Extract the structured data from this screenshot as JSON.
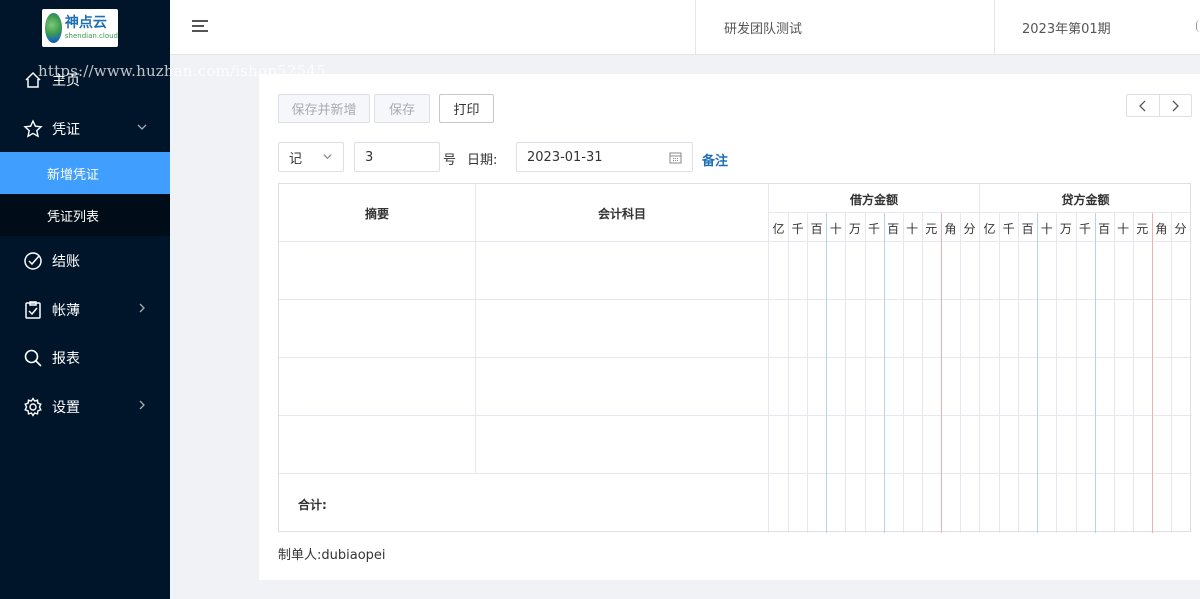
{
  "logo": {
    "cn": "神点云",
    "en": "shendian.cloud"
  },
  "watermark": "https://www.huzhan.com/ishop52545",
  "sidebar": {
    "items": [
      {
        "label": "主页",
        "icon": "home-icon"
      },
      {
        "label": "凭证",
        "icon": "star-icon"
      },
      {
        "label": "结账",
        "icon": "check-circle-icon"
      },
      {
        "label": "帐薄",
        "icon": "clipboard-icon"
      },
      {
        "label": "报表",
        "icon": "search-icon"
      },
      {
        "label": "设置",
        "icon": "gear-icon"
      }
    ],
    "submenu": [
      {
        "label": "新增凭证",
        "active": true
      },
      {
        "label": "凭证列表",
        "active": false
      }
    ]
  },
  "header": {
    "team": "研发团队测试",
    "period": "2023年第01期"
  },
  "toolbar": {
    "save_new": "保存并新增",
    "save": "保存",
    "print": "打印",
    "prev": "‹",
    "next": "›"
  },
  "form": {
    "voucher_word": "记",
    "voucher_no": "3",
    "no_suffix": "号",
    "date_label": "日期:",
    "date_value": "2023-01-31",
    "note_link": "备注"
  },
  "grid": {
    "col_summary": "摘要",
    "col_account": "会计科目",
    "col_debit": "借方金额",
    "col_credit": "贷方金额",
    "digits": [
      "亿",
      "千",
      "百",
      "十",
      "万",
      "千",
      "百",
      "十",
      "元",
      "角",
      "分"
    ],
    "total_label": "合计:"
  },
  "footer": {
    "maker_label": "制单人:",
    "maker_name": "dubiaopei"
  },
  "colors": {
    "sidebar_bg": "#001529",
    "active_item": "#409eff",
    "link": "#1f6fb5"
  }
}
